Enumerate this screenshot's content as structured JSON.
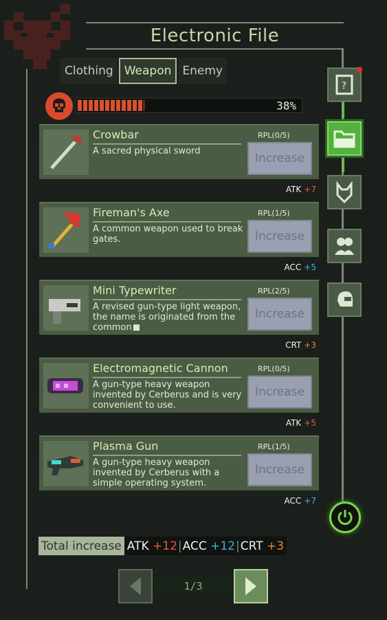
{
  "title": "Electronic File",
  "tabs": [
    {
      "label": "Clothing",
      "active": false
    },
    {
      "label": "Weapon",
      "active": true
    },
    {
      "label": "Enemy",
      "active": false
    }
  ],
  "progress": {
    "percent_text": "38%",
    "value": 0.38
  },
  "weapons": [
    {
      "name": "Crowbar",
      "desc": "A sacred physical sword",
      "rpl": "RPL(0/5)",
      "button": "Increase",
      "stat": "ATK",
      "bonus": "+7",
      "bonus_color": "#e85a44",
      "icon": "crowbar-icon",
      "truncated": false
    },
    {
      "name": "Fireman's Axe",
      "desc": "A common weapon used to break gates.",
      "rpl": "RPL(1/5)",
      "button": "Increase",
      "stat": "ACC",
      "bonus": "+5",
      "bonus_color": "#3db2e0",
      "icon": "axe-icon",
      "truncated": false
    },
    {
      "name": "Mini Typewriter",
      "desc": "A revised gun-type light weapon, the name is originated from the common",
      "rpl": "RPL(2/5)",
      "button": "Increase",
      "stat": "CRT",
      "bonus": "+3",
      "bonus_color": "#e0883a",
      "icon": "gun-icon",
      "truncated": true
    },
    {
      "name": "Electromagnetic Cannon",
      "desc": "A gun-type heavy weapon invented by Cerberus and is very convenient to use.",
      "rpl": "RPL(0/5)",
      "button": "Increase",
      "stat": "ATK",
      "bonus": "+5",
      "bonus_color": "#e85a44",
      "icon": "cannon-icon",
      "truncated": false
    },
    {
      "name": "Plasma Gun",
      "desc": "A gun-type heavy weapon invented by Cerberus with a simple operating system.",
      "rpl": "RPL(1/5)",
      "button": "Increase",
      "stat": "ACC",
      "bonus": "+7",
      "bonus_color": "#3db2e0",
      "icon": "plasma-gun-icon",
      "truncated": false
    }
  ],
  "totals": {
    "label": "Total increase",
    "atk_label": "ATK",
    "atk_value": "+12",
    "acc_label": "ACC",
    "acc_value": "+12",
    "crt_label": "CRT",
    "crt_value": "+3"
  },
  "pager": {
    "text": "1/3"
  },
  "side_buttons": [
    {
      "icon": "document-icon",
      "active": false,
      "notification": true
    },
    {
      "icon": "folder-icon",
      "active": true,
      "notification": false
    },
    {
      "icon": "wolf-icon",
      "active": false,
      "notification": false
    },
    {
      "icon": "people-icon",
      "active": false,
      "notification": false
    },
    {
      "icon": "helmet-icon",
      "active": false,
      "notification": false
    }
  ]
}
